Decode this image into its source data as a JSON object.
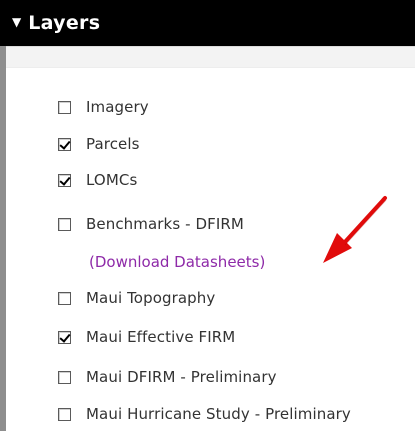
{
  "panel": {
    "title": "Layers",
    "caret_icon": "triangle-down-icon"
  },
  "layers": [
    {
      "label": "Imagery",
      "checked": false
    },
    {
      "label": "Parcels",
      "checked": true
    },
    {
      "label": "LOMCs",
      "checked": true
    },
    {
      "label": "Benchmarks - DFIRM",
      "checked": false
    },
    {
      "label": "Maui Topography",
      "checked": false
    },
    {
      "label": "Maui Effective FIRM",
      "checked": true
    },
    {
      "label": "Maui DFIRM - Preliminary",
      "checked": false
    },
    {
      "label": "Maui Hurricane Study - Preliminary",
      "checked": false
    }
  ],
  "benchmarks_link": {
    "label": "(Download Datasheets)"
  },
  "annotation": {
    "icon": "red-arrow-icon",
    "color": "#e10b0b"
  }
}
